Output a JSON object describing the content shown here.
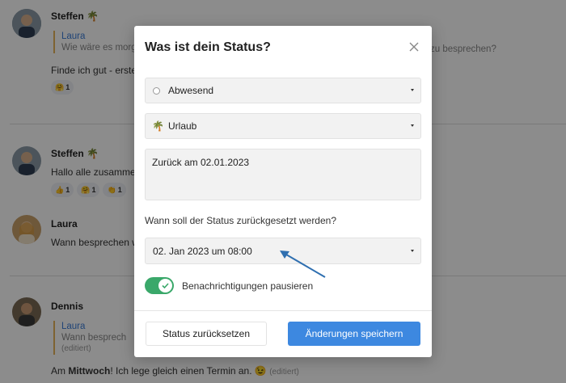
{
  "chat": {
    "messages": [
      {
        "author": "Steffen 🌴",
        "quote_name": "Laura",
        "quote_text": "Wie wäre es morg",
        "quote_text_right": "zu besprechen?",
        "text": "Finde ich gut - erste",
        "reactions": [
          {
            "emoji": "🤗",
            "count": "1"
          }
        ]
      },
      {
        "author": "Steffen 🌴",
        "text": "Hallo alle zusamme",
        "reactions": [
          {
            "emoji": "👍",
            "count": "1"
          },
          {
            "emoji": "🤗",
            "count": "1"
          },
          {
            "emoji": "👏",
            "count": "1"
          }
        ]
      },
      {
        "author": "Laura",
        "text": "Wann besprechen w"
      },
      {
        "author": "Dennis",
        "quote_name": "Laura",
        "quote_text": "Wann besprech",
        "quote_edited": "(editiert)",
        "text_prefix": "Am ",
        "text_bold": "Mittwoch",
        "text_suffix": "! Ich lege gleich einen Termin an.",
        "text_emoji": "😉",
        "text_edited": "(editiert)"
      }
    ]
  },
  "modal": {
    "title": "Was ist dein Status?",
    "presence": "Abwesend",
    "status_emoji": "🌴",
    "status": "Urlaub",
    "message": "Zurück am 02.01.2023",
    "reset_question": "Wann soll der Status zurückgesetzt werden?",
    "reset_date": "02. Jan 2023 um 08:00",
    "toggle_label": "Benachrichtigungen pausieren",
    "toggle_on": true,
    "reset_button": "Status zurücksetzen",
    "save_button": "Änderungen speichern"
  },
  "colors": {
    "accent": "#3d88e0",
    "toggle": "#3aa86a",
    "arrow": "#2f6fb0"
  }
}
